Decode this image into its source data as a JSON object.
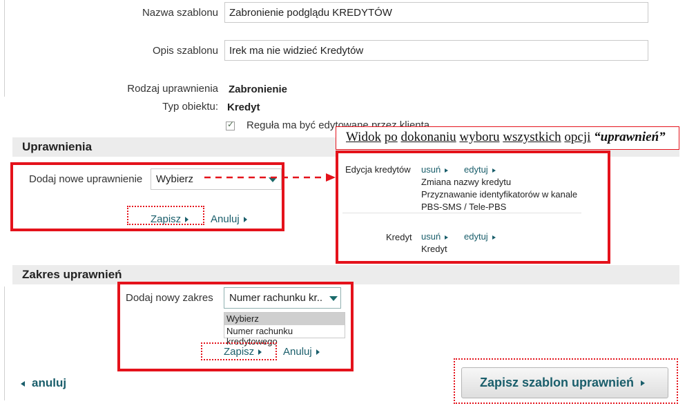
{
  "form": {
    "template_name_label": "Nazwa szablonu",
    "template_name_value": "Zabronienie podglądu KREDYTÓW",
    "template_desc_label": "Opis szablonu",
    "template_desc_value": "Irek ma nie widzieć Kredytów",
    "perm_type_label": "Rodzaj uprawnienia",
    "perm_type_value": "Zabronienie",
    "object_type_label": "Typ obiektu:",
    "object_type_value": "Kredyt",
    "rule_checkbox_label": "Reguła ma być edytowane przez klienta",
    "rule_checked": true
  },
  "permissions": {
    "section_title": "Uprawnienia",
    "add_label": "Dodaj nowe uprawnienie",
    "select_value": "Wybierz",
    "save_label": "Zapisz",
    "cancel_label": "Anuluj"
  },
  "popup": {
    "title_word1": "Widok",
    "title_word2": "po",
    "title_word3": "dokonaniu",
    "title_word4": "wyboru",
    "title_word5": "wszystkich",
    "title_word6": "opcji",
    "title_emphasis": "“uprawnień”",
    "rows": [
      {
        "name": "Edycja kredytów",
        "remove_label": "usuń",
        "edit_label": "edytuj",
        "details": [
          "Zmiana nazwy kredytu",
          "Przyznawanie identyfikatorów w kanale",
          "PBS-SMS / Tele-PBS"
        ]
      },
      {
        "name": "Kredyt",
        "remove_label": "usuń",
        "edit_label": "edytuj",
        "details": [
          "Kredyt"
        ]
      }
    ]
  },
  "scope": {
    "section_title": "Zakres uprawnień",
    "add_label": "Dodaj nowy zakres",
    "select_value": "Numer rachunku kr..",
    "options": [
      "Wybierz",
      "Numer rachunku kredytowego"
    ],
    "selected_option_index": 0,
    "save_label": "Zapisz",
    "cancel_label": "Anuluj"
  },
  "footer": {
    "back_label": "anuluj",
    "save_template_label": "Zapisz szablon uprawnień"
  },
  "colors": {
    "accent": "#1a5e6b",
    "highlight_red": "#e4121b",
    "section_bg": "#ececec"
  }
}
